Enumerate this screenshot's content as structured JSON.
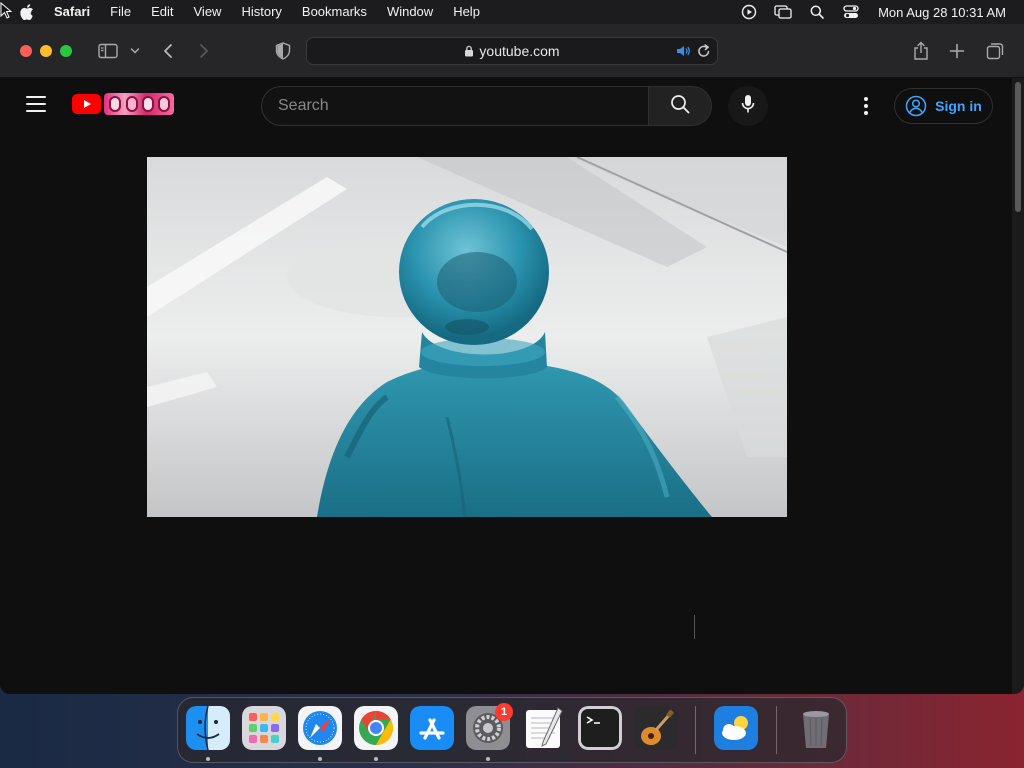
{
  "menubar": {
    "app_name": "Safari",
    "menus": [
      "File",
      "Edit",
      "View",
      "History",
      "Bookmarks",
      "Window",
      "Help"
    ],
    "clock": "Mon Aug 28  10:31 AM",
    "status_icons": [
      "play-circle-icon",
      "screen-mirroring-icon",
      "spotlight-search-icon",
      "control-center-icon"
    ]
  },
  "browser": {
    "address": "youtube.com",
    "colors": {
      "close": "#ff5f57",
      "minimize": "#febc2e",
      "zoom": "#28c840"
    }
  },
  "youtube": {
    "search_placeholder": "Search",
    "sign_in_label": "Sign in",
    "colors": {
      "brand_red": "#ff0000",
      "sign_in_blue": "#3ea6ff",
      "background": "#0f0f0f"
    }
  },
  "dock": {
    "badge_count": "1",
    "apps": [
      "Finder",
      "Launchpad",
      "Safari",
      "Google Chrome",
      "App Store",
      "System Settings",
      "TextEdit",
      "Terminal",
      "GarageBand",
      "Weather",
      "Trash"
    ]
  }
}
